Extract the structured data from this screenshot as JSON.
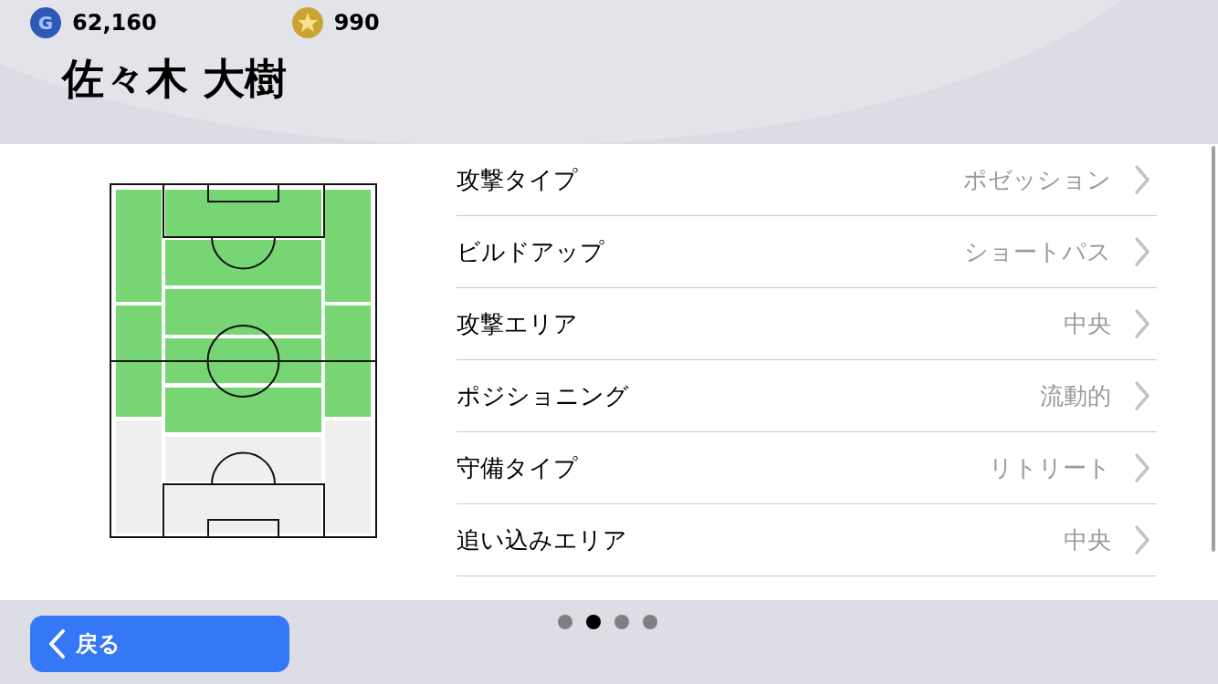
{
  "currencies": [
    {
      "kind": "gp",
      "amount": "62,160",
      "icon_text": "G"
    },
    {
      "kind": "coin",
      "amount": "990"
    }
  ],
  "player_name": "佐々木 大樹",
  "pitch": {
    "left": [
      {
        "on": true
      },
      {
        "on": true
      },
      {
        "on": false
      }
    ],
    "center": [
      {
        "on": true
      },
      {
        "on": true
      },
      {
        "on": true
      },
      {
        "on": true
      },
      {
        "on": true
      },
      {
        "on": false
      },
      {
        "on": false
      }
    ],
    "right": [
      {
        "on": true
      },
      {
        "on": true
      },
      {
        "on": false
      }
    ]
  },
  "settings": [
    {
      "label": "攻撃タイプ",
      "value": "ポゼッション"
    },
    {
      "label": "ビルドアップ",
      "value": "ショートパス"
    },
    {
      "label": "攻撃エリア",
      "value": "中央"
    },
    {
      "label": "ポジショニング",
      "value": "流動的"
    },
    {
      "label": "守備タイプ",
      "value": "リトリート"
    },
    {
      "label": "追い込みエリア",
      "value": "中央"
    }
  ],
  "pages": [
    {
      "selected": false
    },
    {
      "selected": true
    },
    {
      "selected": false
    },
    {
      "selected": false
    }
  ],
  "back_button": {
    "label": "戻る"
  }
}
